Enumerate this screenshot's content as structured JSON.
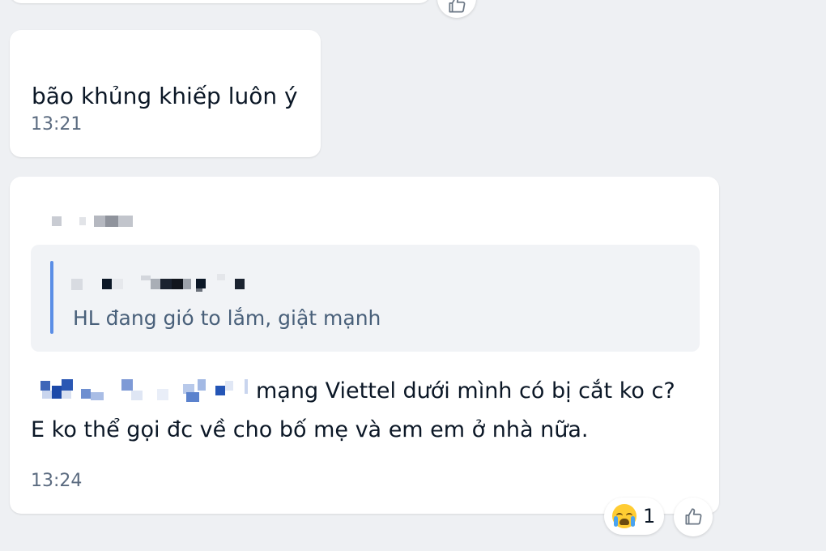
{
  "messages": [
    {
      "text": "bão khủng khiếp luôn ý",
      "time": "13:21"
    },
    {
      "quote": {
        "text": "HL đang gió to lắm, giật mạnh"
      },
      "body_line1": "mạng Viettel dưới mình có bị cắt ko c?",
      "body_line2": "E ko thể gọi đc về cho bố mẹ và em em ở nhà nữa.",
      "time": "13:24",
      "reactions": [
        {
          "icon": "crying-face-emoji",
          "count": "1"
        }
      ]
    }
  ],
  "icons": {
    "like": "thumbs-up-icon"
  },
  "colors": {
    "background": "#eef0f3",
    "bubble": "#ffffff",
    "quote_bar": "#5b8ee6",
    "quote_background": "#f1f3f6",
    "timestamp": "#5b6b80"
  }
}
